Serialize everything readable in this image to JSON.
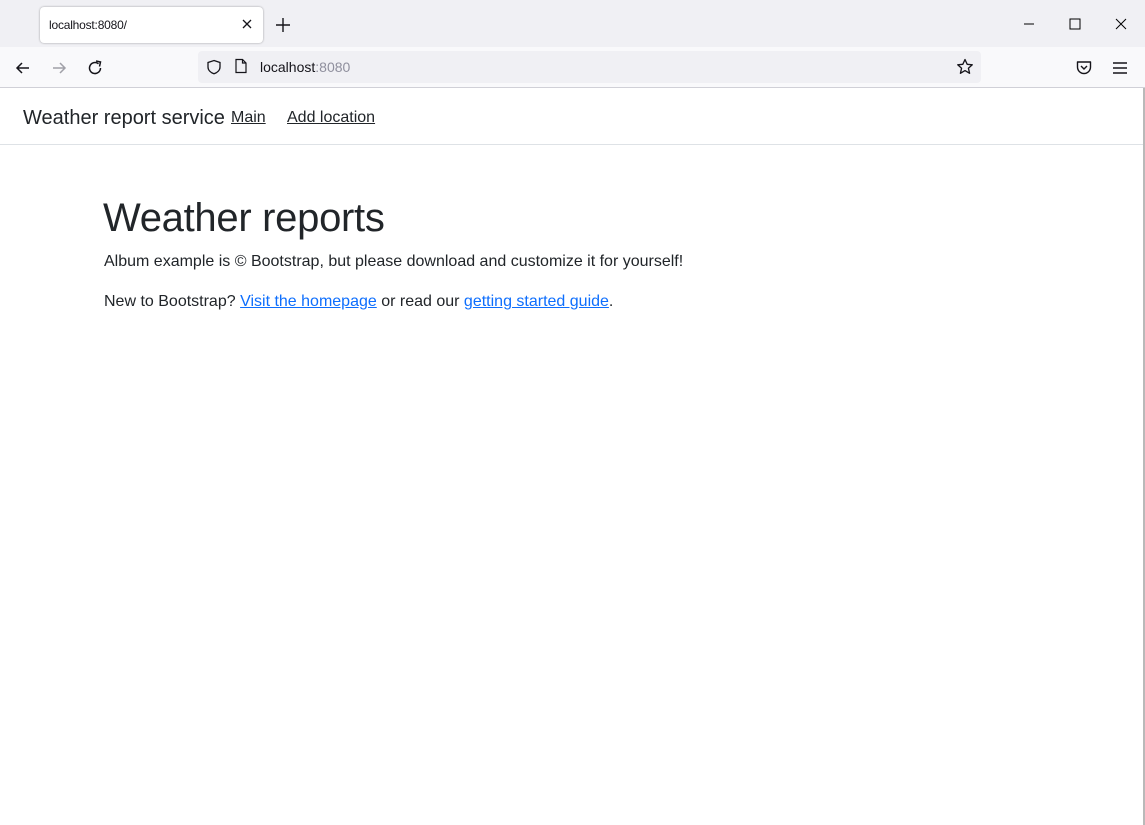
{
  "browser": {
    "tab_title": "localhost:8080/",
    "url_host": "localhost",
    "url_port": ":8080"
  },
  "site": {
    "brand": "Weather report service",
    "nav": [
      {
        "label": "Main"
      },
      {
        "label": "Add location"
      }
    ]
  },
  "main": {
    "title": "Weather reports",
    "lead": "Album example is © Bootstrap, but please download and customize it for yourself!",
    "para_prefix": "New to Bootstrap? ",
    "link1": "Visit the homepage",
    "para_middle": " or read our ",
    "link2": "getting started guide",
    "para_suffix": "."
  },
  "colors": {
    "link": "#0d6efd",
    "text": "#212529",
    "chrome_bg": "#f0f0f4"
  }
}
